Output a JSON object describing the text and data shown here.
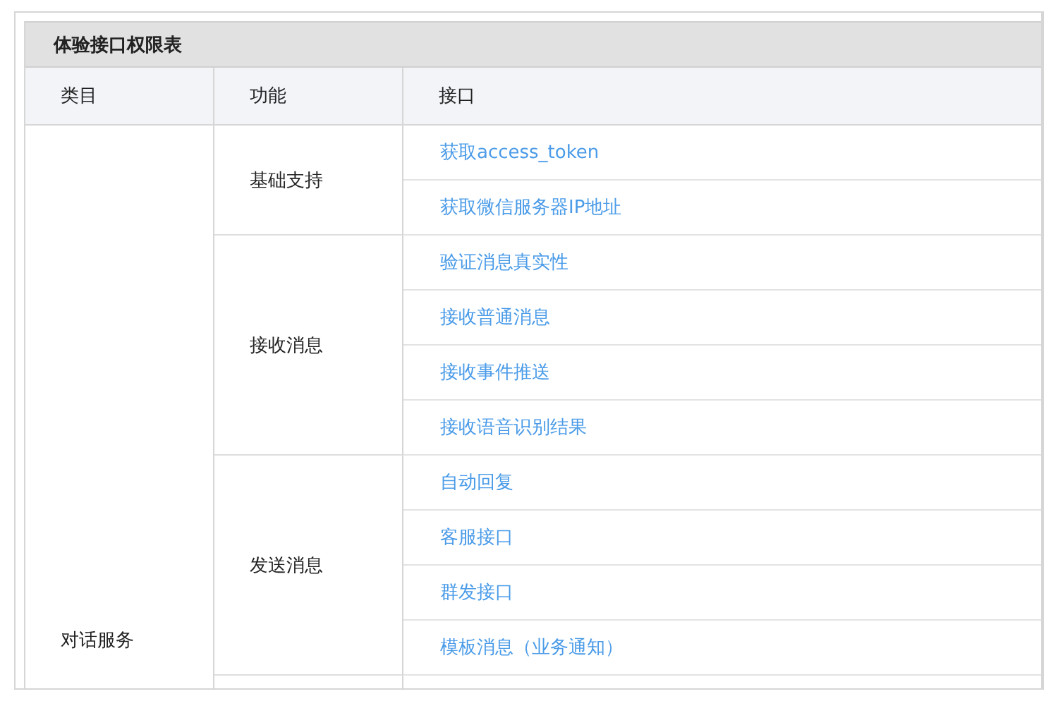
{
  "table": {
    "title": "体验接口权限表",
    "columns": [
      "类目",
      "功能",
      "接口"
    ],
    "categories": [
      {
        "name": "对话服务",
        "functions": [
          {
            "name": "基础支持",
            "interfaces": [
              "获取access_token",
              "获取微信服务器IP地址"
            ]
          },
          {
            "name": "接收消息",
            "interfaces": [
              "验证消息真实性",
              "接收普通消息",
              "接收事件推送",
              "接收语音识别结果"
            ]
          },
          {
            "name": "发送消息",
            "interfaces": [
              "自动回复",
              "客服接口",
              "群发接口",
              "模板消息（业务通知）"
            ]
          }
        ]
      }
    ]
  }
}
